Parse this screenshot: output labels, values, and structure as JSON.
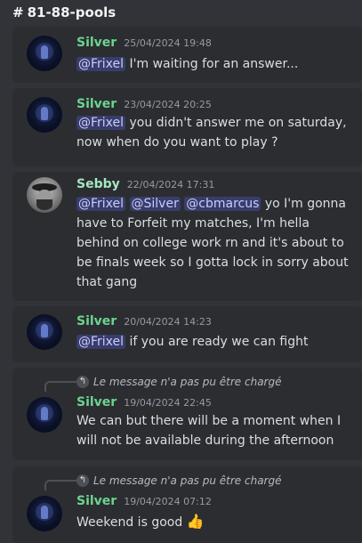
{
  "channel": {
    "hash": "#",
    "name": "81-88-pools"
  },
  "messages": [
    {
      "author": "Silver",
      "timestamp": "25/04/2024 19:48",
      "mentions": [
        "@Frixel"
      ],
      "text": "I'm waiting for an answer..."
    },
    {
      "author": "Silver",
      "timestamp": "23/04/2024 20:25",
      "mentions": [
        "@Frixel"
      ],
      "text_line1": "you didn't answer me on saturday,",
      "text_line2": "now when do you want to play ?"
    },
    {
      "author": "Sebby",
      "timestamp": "22/04/2024 17:31",
      "mentions": [
        "@Frixel",
        "@Silver",
        "@cbmarcus"
      ],
      "text_line1": "yo I'm gonna",
      "text_line2": "have to Forfeit my matches, I'm hella",
      "text_line3": "behind on college work rn and it's about to",
      "text_line4": "be finals week so I gotta lock in sorry about",
      "text_line5": "that gang"
    },
    {
      "author": "Silver",
      "timestamp": "20/04/2024 14:23",
      "mentions": [
        "@Frixel"
      ],
      "text": "if you are ready we can fight"
    },
    {
      "reply_notice": "Le message n'a pas pu être chargé",
      "author": "Silver",
      "timestamp": "19/04/2024 22:45",
      "text_line1": "We can but there will be a moment when I",
      "text_line2": "will not be available during the afternoon"
    },
    {
      "reply_notice": "Le message n'a pas pu être chargé",
      "author": "Silver",
      "timestamp": "19/04/2024 07:12",
      "text": "Weekend is good",
      "emoji": "👍"
    }
  ],
  "icons": {
    "reply": "reply-arrow-icon",
    "avatar_silver": "avatar",
    "avatar_sebby": "avatar"
  },
  "colors": {
    "background": "#313338",
    "message_bg": "#2b2d31",
    "silver_name": "#6cd48e",
    "sebby_name": "#a6e6c0",
    "mention_bg": "#5865f24d"
  }
}
